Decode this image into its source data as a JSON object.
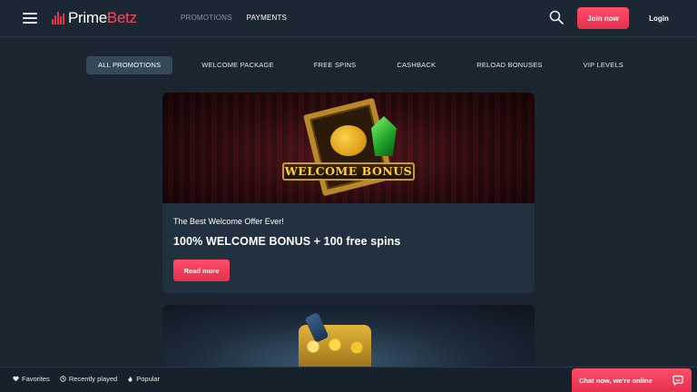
{
  "header": {
    "logo": {
      "prefix": "Prime",
      "suffix": "Betz"
    },
    "nav": [
      {
        "label": "PROMOTIONS",
        "active": false
      },
      {
        "label": "PAYMENTS",
        "active": true
      }
    ],
    "join_label": "Join now",
    "login_label": "Login",
    "icons": {
      "menu": "hamburger-icon",
      "search": "search-icon"
    }
  },
  "tabs": [
    {
      "label": "ALL PROMOTIONS",
      "active": true
    },
    {
      "label": "WELCOME PACKAGE",
      "active": false
    },
    {
      "label": "FREE SPINS",
      "active": false
    },
    {
      "label": "CASHBACK",
      "active": false
    },
    {
      "label": "RELOAD BONUSES",
      "active": false
    },
    {
      "label": "VIP LEVELS",
      "active": false
    }
  ],
  "promotions": [
    {
      "image_text": "WELCOME BONUS",
      "subtitle": "The Best Welcome Offer Ever!",
      "title": "100% WELCOME BONUS + 100 free spins",
      "button_label": "Read more"
    }
  ],
  "bottom_bar": {
    "items": [
      {
        "label": "Favorites",
        "icon": "heart-icon"
      },
      {
        "label": "Recently played",
        "icon": "clock-icon"
      },
      {
        "label": "Popular",
        "icon": "flame-icon"
      }
    ]
  },
  "chat": {
    "label": "Chat now, we're online",
    "icon": "chat-bubble-icon"
  },
  "colors": {
    "background": "#1a2530",
    "card": "#213140",
    "accent": "#e5304e",
    "active_tab": "#34495a"
  }
}
